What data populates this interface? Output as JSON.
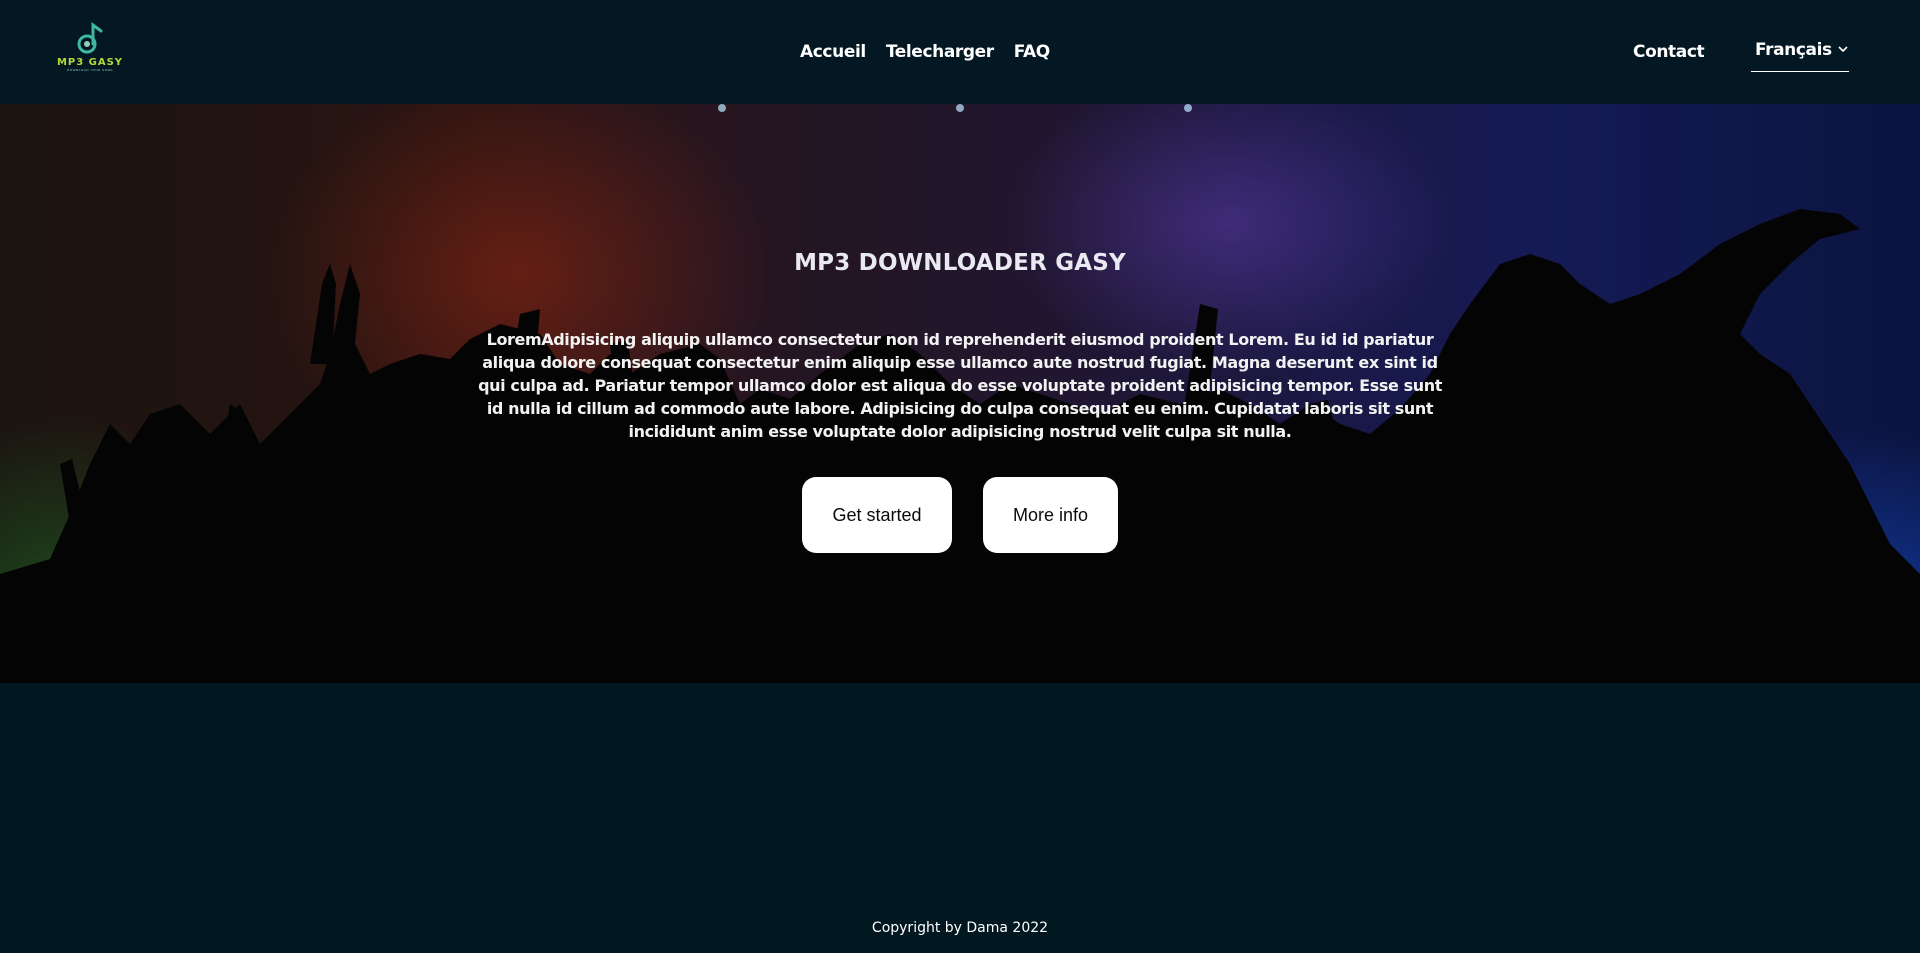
{
  "brand": {
    "logo_icon": "music-note-icon",
    "logo_text": "MP3 GASY",
    "logo_tagline": "DOWNLOAD YOUR SONG"
  },
  "nav": {
    "links": [
      "Accueil",
      "Telecharger",
      "FAQ"
    ],
    "contact": "Contact",
    "language": "Français"
  },
  "hero": {
    "title": "MP3 DOWNLOADER GASY",
    "description": "LoremAdipisicing aliquip ullamco consectetur non id reprehenderit eiusmod proident Lorem. Eu id id pariatur aliqua dolore consequat consectetur enim aliquip esse ullamco aute nostrud fugiat. Magna deserunt ex sint id qui culpa ad. Pariatur tempor ullamco dolor est aliqua do esse voluptate proident adipisicing tempor. Esse sunt id nulla id cillum ad commodo aute labore. Adipisicing do culpa consequat eu enim. Cupidatat laboris sit sunt incididunt anim esse voluptate dolor adipisicing nostrud velit culpa sit nulla.",
    "primary_button": "Get started",
    "secondary_button": "More info"
  },
  "footer": {
    "copyright": "Copyright by Dama 2022"
  },
  "colors": {
    "background": "#021820",
    "navbar": "#031822",
    "button_bg": "#ffffff",
    "logo_accent": "#b6d93a",
    "logo_icon": "#3fb8a0"
  }
}
